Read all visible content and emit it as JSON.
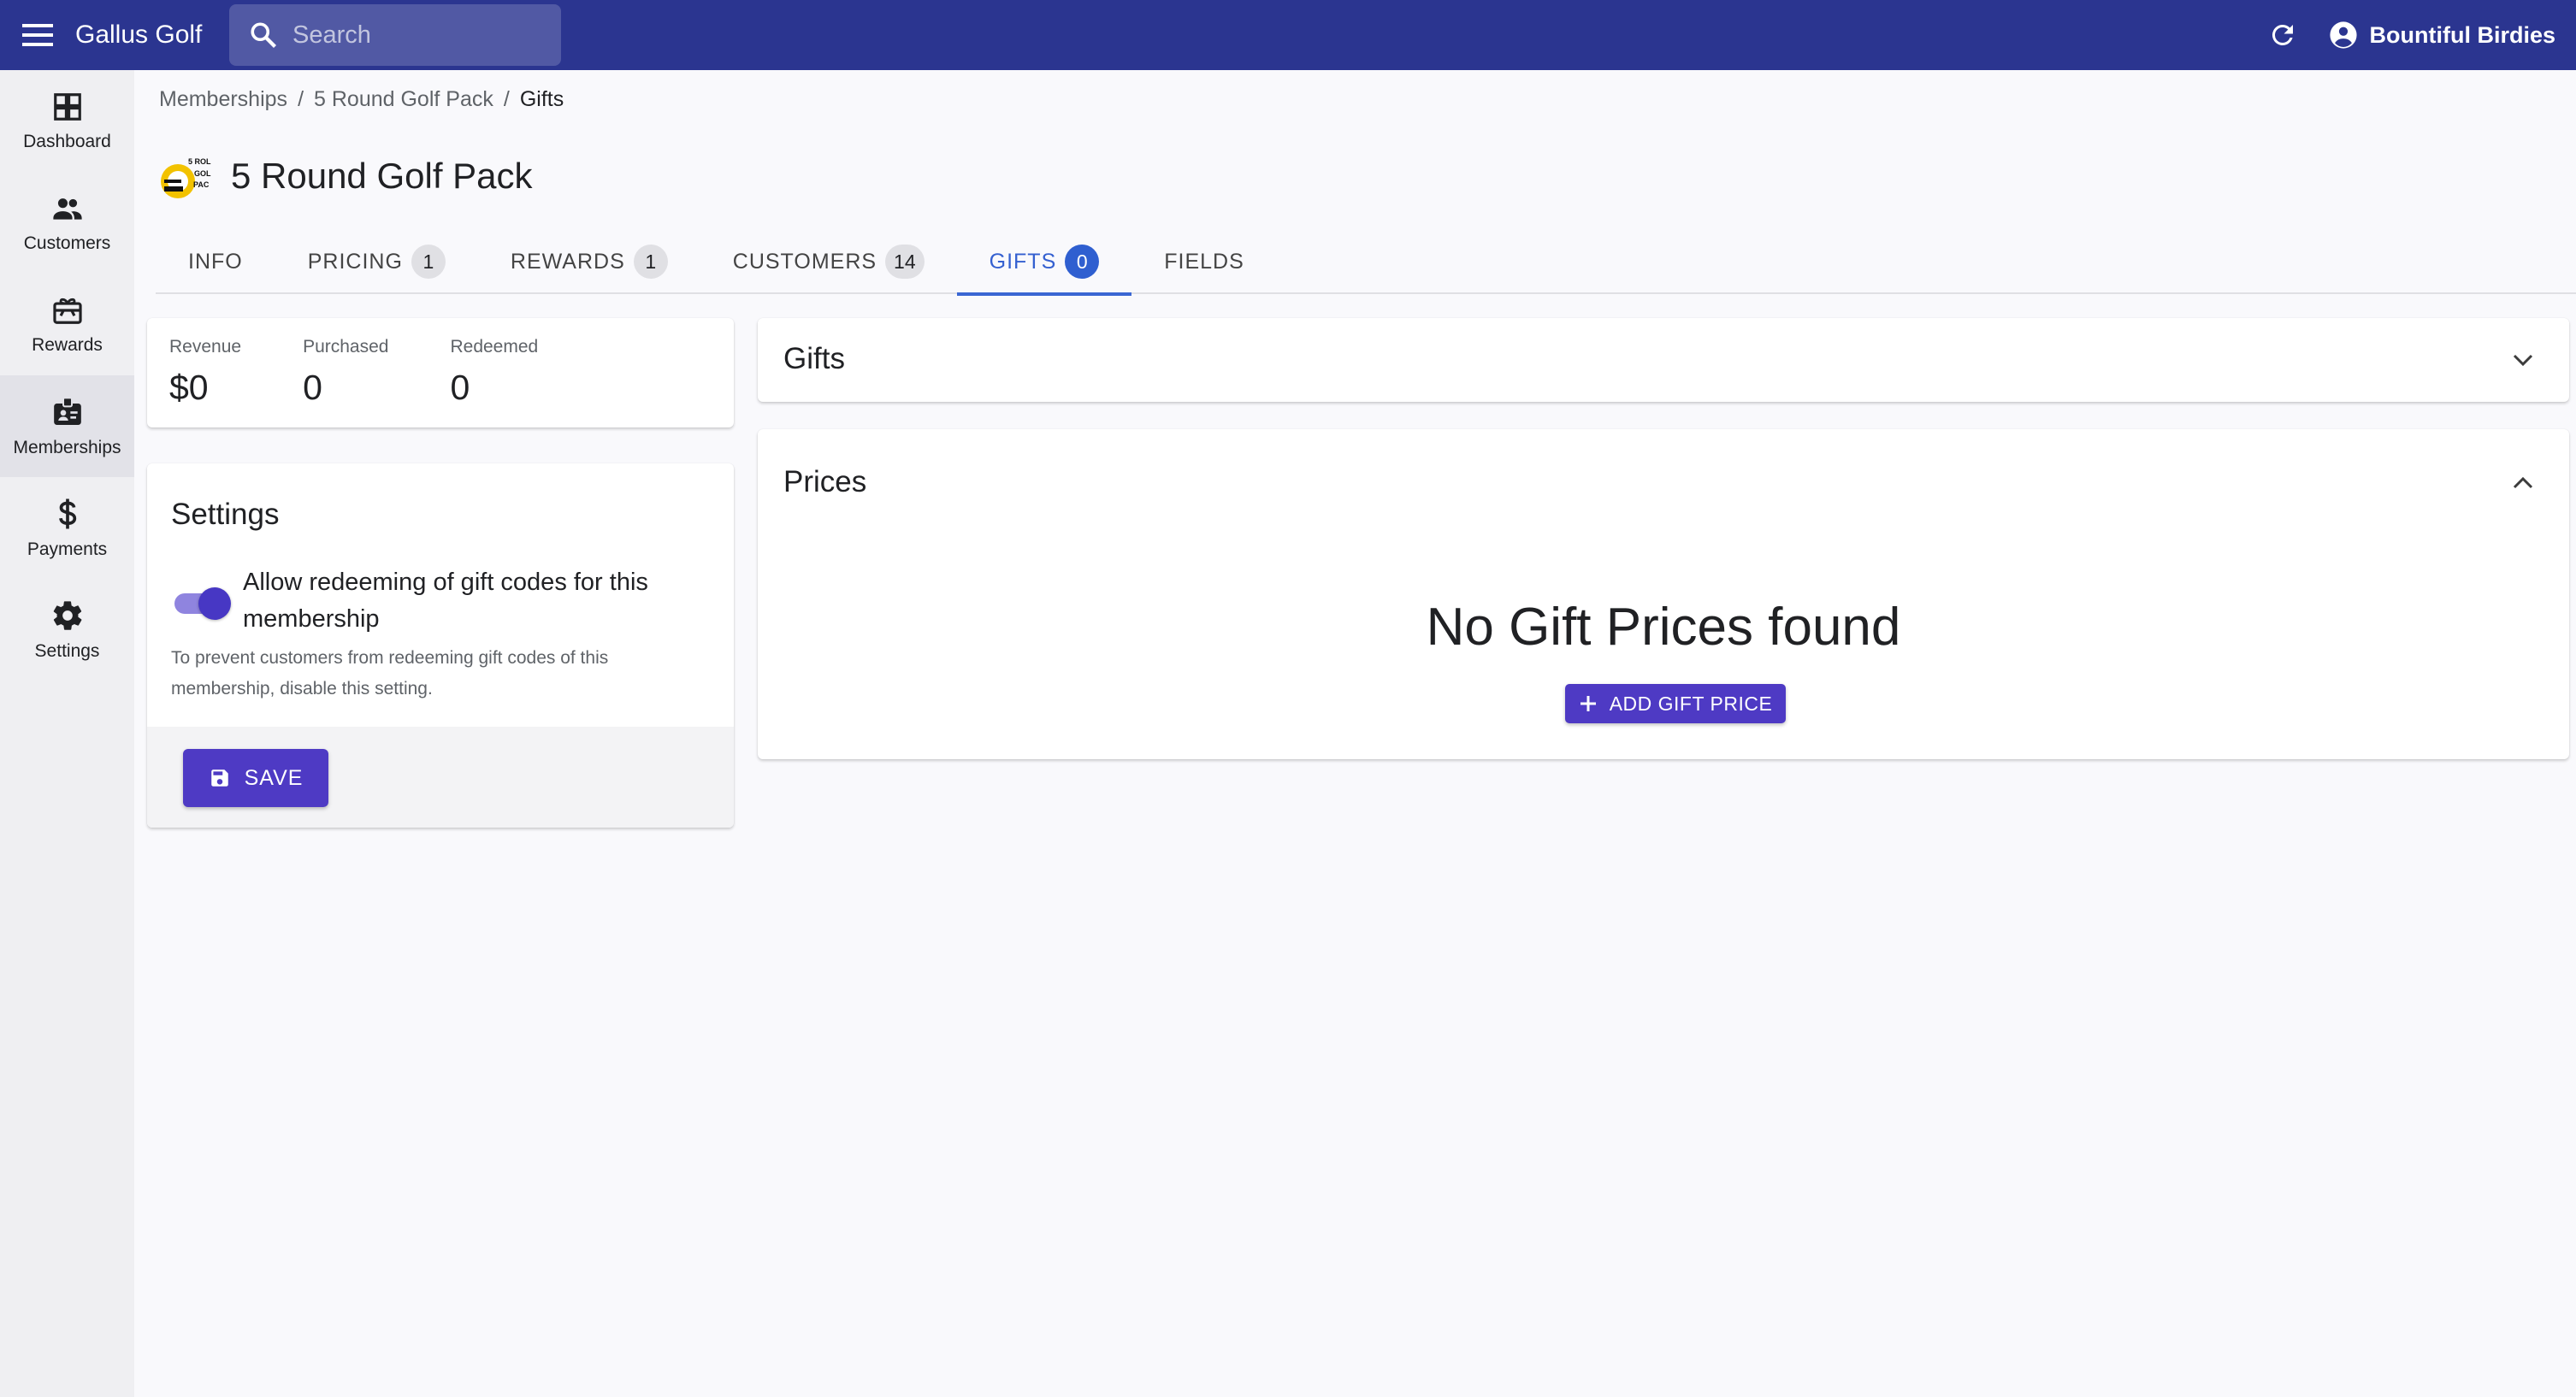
{
  "app": {
    "title": "Gallus Golf",
    "search_placeholder": "Search",
    "account_name": "Bountiful Birdies",
    "brand_color": "#2b3590",
    "accent_color": "#4e3ac4"
  },
  "sidebar": {
    "items": [
      {
        "label": "Dashboard",
        "icon": "dashboard-icon"
      },
      {
        "label": "Customers",
        "icon": "people-icon"
      },
      {
        "label": "Rewards",
        "icon": "gift-card-icon"
      },
      {
        "label": "Memberships",
        "icon": "membership-badge-icon",
        "active": true
      },
      {
        "label": "Payments",
        "icon": "dollar-icon"
      },
      {
        "label": "Settings",
        "icon": "gear-icon"
      }
    ]
  },
  "breadcrumb": [
    "Memberships",
    "5 Round Golf Pack",
    "Gifts"
  ],
  "page": {
    "title": "5 Round Golf Pack",
    "logo_text": [
      "5 ROL",
      "GOL",
      "PAC"
    ]
  },
  "tabs": [
    {
      "label": "INFO",
      "count": ""
    },
    {
      "label": "PRICING",
      "count": "1"
    },
    {
      "label": "REWARDS",
      "count": "1"
    },
    {
      "label": "CUSTOMERS",
      "count": "14"
    },
    {
      "label": "GIFTS",
      "count": "0",
      "active": true
    },
    {
      "label": "FIELDS",
      "count": ""
    }
  ],
  "stats": {
    "revenue": {
      "label": "Revenue",
      "value": "$0"
    },
    "purchased": {
      "label": "Purchased",
      "value": "0"
    },
    "redeemed": {
      "label": "Redeemed",
      "value": "0"
    }
  },
  "settings": {
    "title": "Settings",
    "toggle_label": "Allow redeeming of gift codes for this membership",
    "toggle_on": true,
    "helper": "To prevent customers from redeeming gift codes of this membership, disable this setting.",
    "save_label": "SAVE"
  },
  "gifts_panel": {
    "title": "Gifts",
    "expanded": false
  },
  "prices_panel": {
    "title": "Prices",
    "expanded": true,
    "empty_message": "No Gift Prices found",
    "add_label": "ADD GIFT PRICE"
  }
}
